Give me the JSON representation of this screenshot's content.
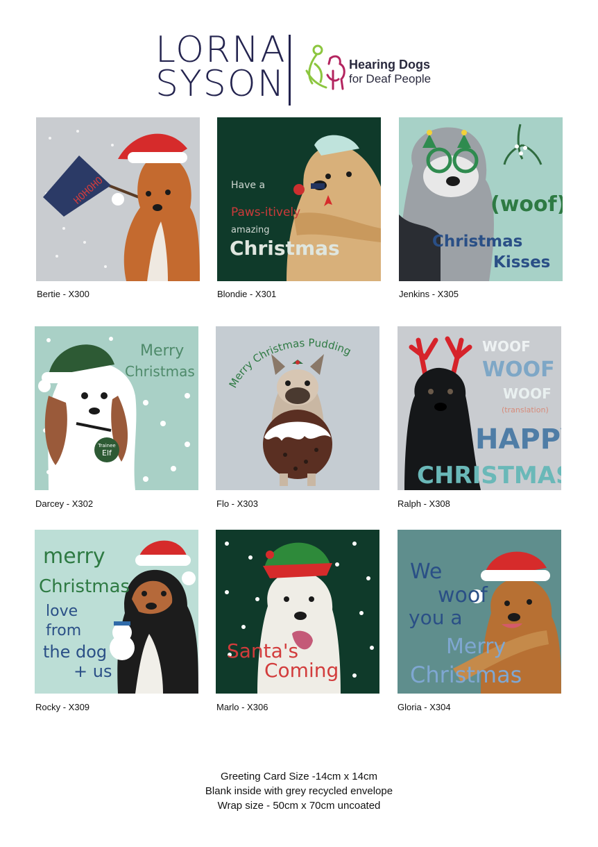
{
  "brand": {
    "line1": "LORNA",
    "line2": "SYSON"
  },
  "partner": {
    "title": "Hearing Dogs",
    "subtitle": "for Deaf People"
  },
  "cards": [
    {
      "caption": "Bertie - X300",
      "text": [
        "HOHOHO"
      ],
      "bg": "#c9ccd0"
    },
    {
      "caption": "Blondie - X301",
      "text": [
        "Have a",
        "Paws-itively",
        "amazing",
        "Christmas"
      ],
      "bg": "#0f3a2a"
    },
    {
      "caption": "Jenkins - X305",
      "text": [
        "(woof)",
        "Christmas",
        "Kisses"
      ],
      "bg": "#a7d1c7"
    },
    {
      "caption": "Darcey - X302",
      "text": [
        "Merry",
        "Christmas",
        "Trainee",
        "Elf"
      ],
      "bg": "#a9d0c6"
    },
    {
      "caption": "Flo - X303",
      "text": [
        "Merry Christmas Pudding"
      ],
      "bg": "#c5ccd2"
    },
    {
      "caption": "Ralph - X308",
      "text": [
        "WOOF",
        "WOOF",
        "WOOF",
        "(translation)",
        "HAPPY",
        "CHRISTMAS"
      ],
      "bg": "#c9ccd0"
    },
    {
      "caption": "Rocky - X309",
      "text": [
        "merry",
        "Christmas",
        "love",
        "from",
        "the dog",
        "+ us"
      ],
      "bg": "#bcded6"
    },
    {
      "caption": "Marlo - X306",
      "text": [
        "Santa's",
        "Coming"
      ],
      "bg": "#0f3a2a"
    },
    {
      "caption": "Gloria - X304",
      "text": [
        "We",
        "woof",
        "you a",
        "Merry",
        "Christmas"
      ],
      "bg": "#5f8e8d"
    }
  ],
  "footer": {
    "line1": "Greeting Card Size -14cm x 14cm",
    "line2": "Blank inside with grey recycled envelope",
    "line3": "Wrap size - 50cm x 70cm uncoated"
  }
}
